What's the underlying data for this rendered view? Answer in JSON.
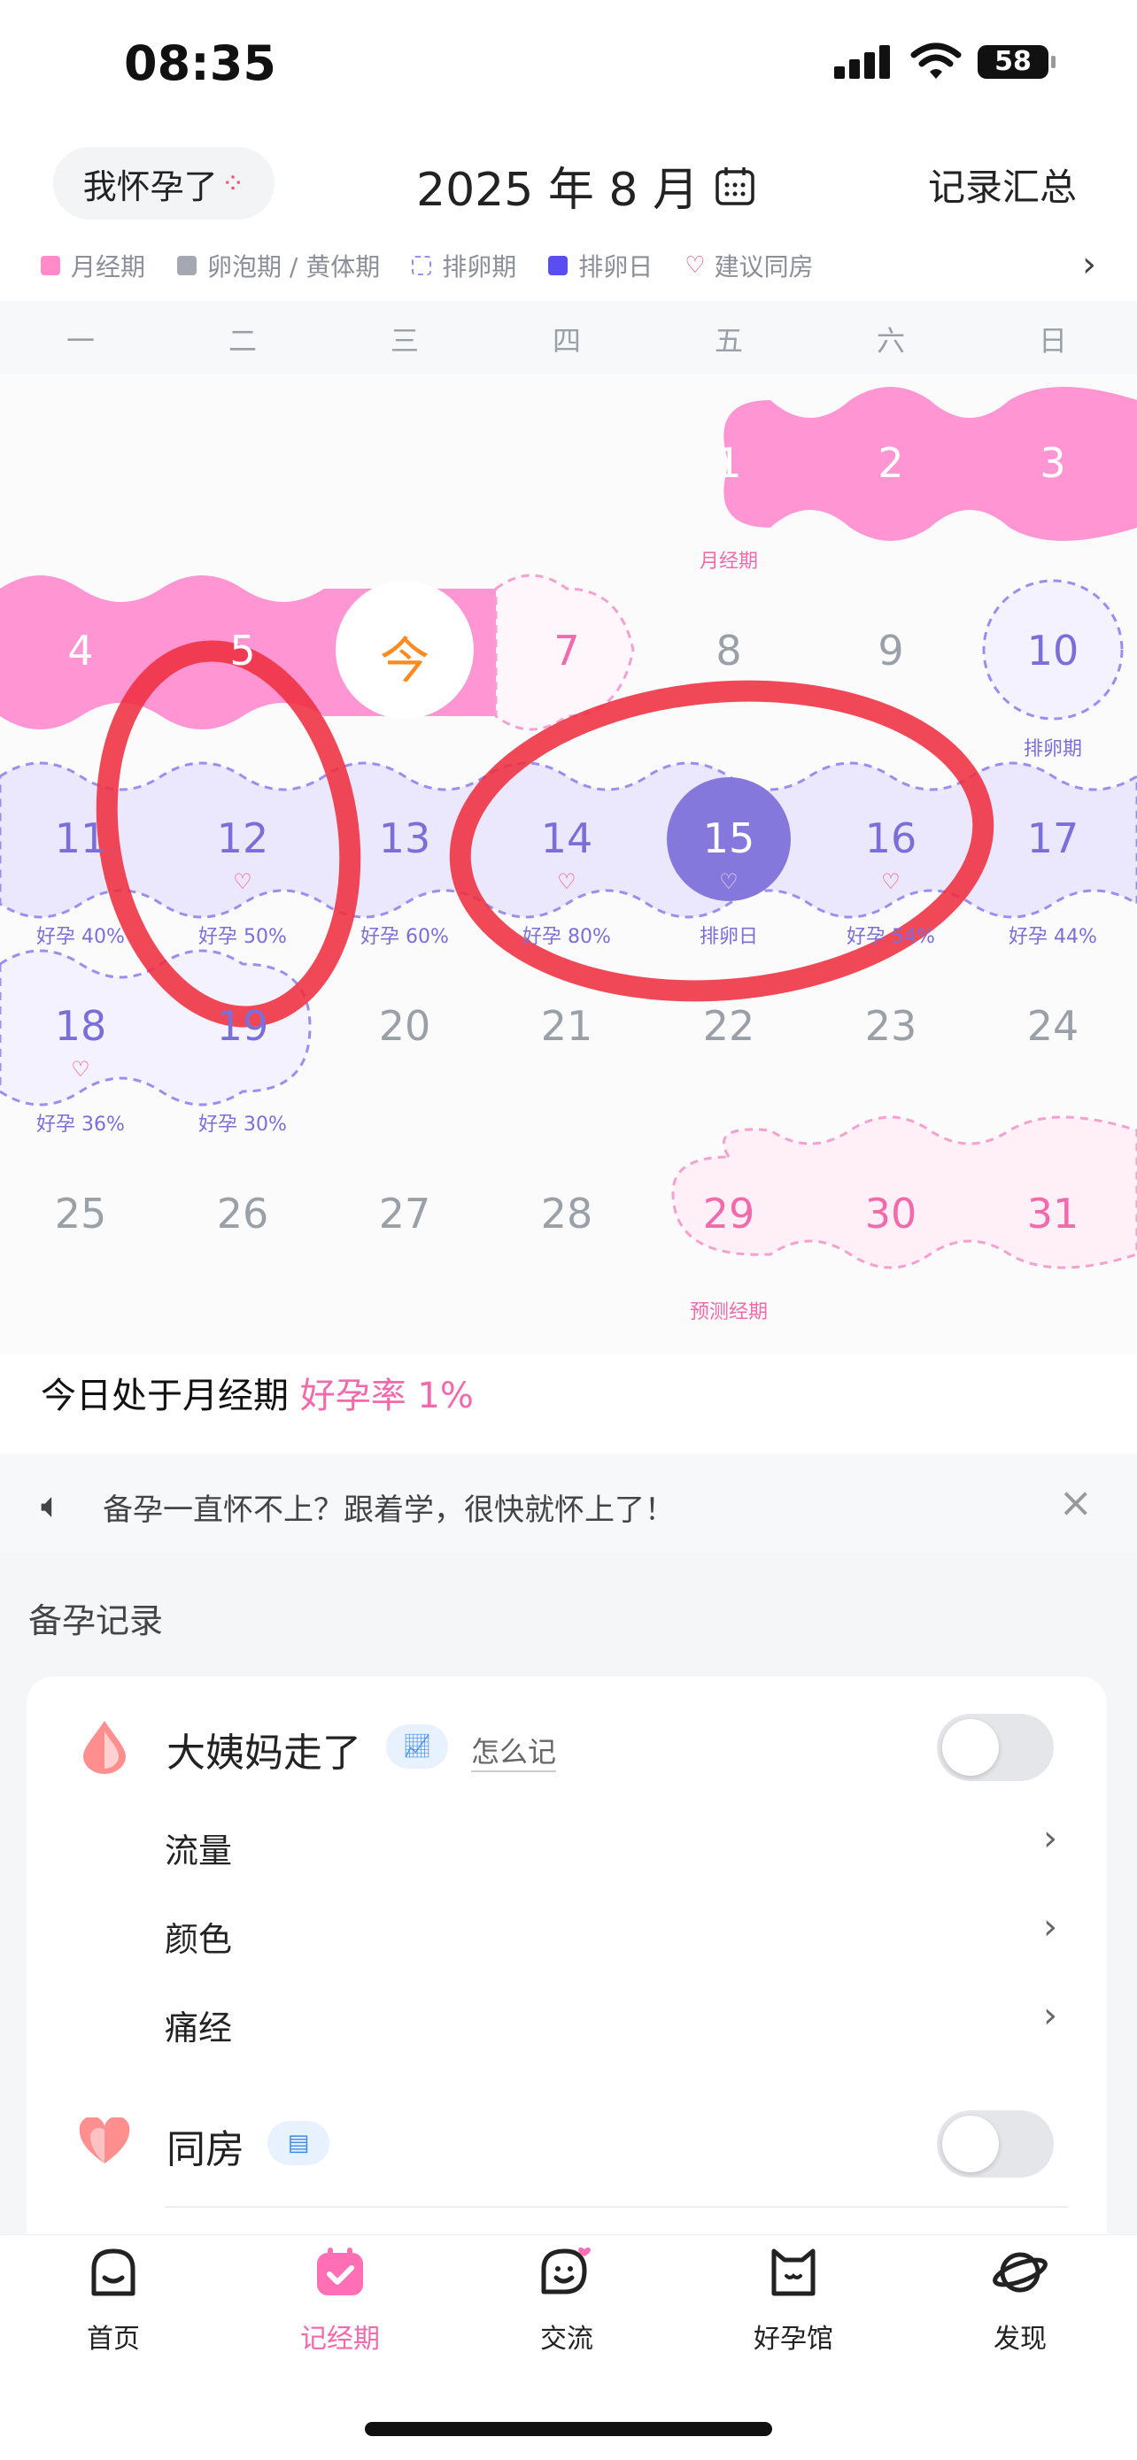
{
  "status_bar": {
    "time": "08:35",
    "battery": "58"
  },
  "header": {
    "pregnant_button": "我怀孕了",
    "month": "2025 年 8 月",
    "summary": "记录汇总"
  },
  "legend": [
    {
      "label": "月经期",
      "color": "#ff8cc8"
    },
    {
      "label": "卵泡期 / 黄体期",
      "color": "#a3a8b2"
    },
    {
      "label": "排卵期",
      "color": "#9b8ef0"
    },
    {
      "label": "排卵日",
      "color": "#5b4ef0"
    },
    {
      "label": "建议同房",
      "color": "#ff4d6d"
    }
  ],
  "weekdays": [
    "一",
    "二",
    "三",
    "四",
    "五",
    "六",
    "日"
  ],
  "calendar": {
    "today_marker": "今",
    "days": [
      {
        "num": "1",
        "label": "月经期"
      },
      {
        "num": "2"
      },
      {
        "num": "3"
      },
      {
        "num": "4"
      },
      {
        "num": "5"
      },
      {
        "num": "7"
      },
      {
        "num": "8"
      },
      {
        "num": "9"
      },
      {
        "num": "10",
        "label": "排卵期"
      },
      {
        "num": "11",
        "label": "好孕 40%"
      },
      {
        "num": "12",
        "label": "好孕 50%"
      },
      {
        "num": "13",
        "label": "好孕 60%"
      },
      {
        "num": "14",
        "label": "好孕 80%"
      },
      {
        "num": "15",
        "label": "排卵日"
      },
      {
        "num": "16",
        "label": "好孕 54%"
      },
      {
        "num": "17",
        "label": "好孕 44%"
      },
      {
        "num": "18",
        "label": "好孕 36%"
      },
      {
        "num": "19",
        "label": "好孕 30%"
      },
      {
        "num": "20"
      },
      {
        "num": "21"
      },
      {
        "num": "22"
      },
      {
        "num": "23"
      },
      {
        "num": "24"
      },
      {
        "num": "25"
      },
      {
        "num": "26"
      },
      {
        "num": "27"
      },
      {
        "num": "28"
      },
      {
        "num": "29",
        "label": "预测经期"
      },
      {
        "num": "30"
      },
      {
        "num": "31"
      }
    ]
  },
  "today_status": {
    "prefix": "今日处于月经期",
    "rate": "好孕率 1%"
  },
  "banner": {
    "text": "备孕一直怀不上？跟着学，很快就怀上了！"
  },
  "records": {
    "title": "备孕记录",
    "period_title": "大姨妈走了",
    "how_to": "怎么记",
    "items": [
      "流量",
      "颜色",
      "痛经"
    ],
    "intercourse_title": "同房"
  },
  "tabs": [
    "首页",
    "记经期",
    "交流",
    "好孕馆",
    "发现"
  ],
  "colors": {
    "pink": "#ff95d3",
    "purple": "#8478dc",
    "accent_text": "#f26aac"
  }
}
